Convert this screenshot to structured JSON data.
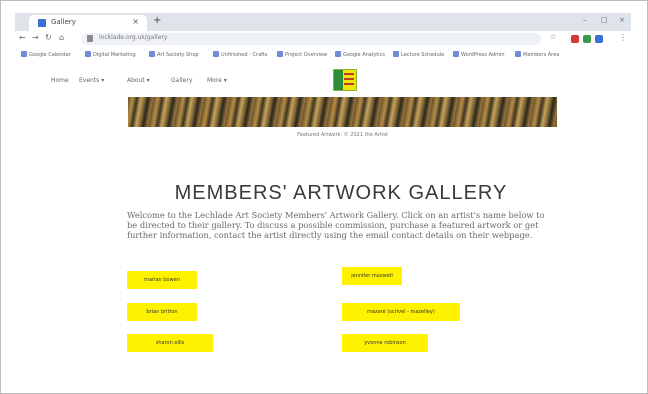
{
  "browser": {
    "tab_title": "Gallery",
    "new_tab_symbol": "+",
    "url": "locklade.org.uk/gallery",
    "window_controls": [
      "–",
      "□",
      "×"
    ],
    "bookmarks": [
      "Google Calendar",
      "Digital Marketing",
      "Art Society Shop",
      "Unfinished - Crafts",
      "Project Overview",
      "Google Analytics",
      "Lecture Schedule",
      "WordPress Admin",
      "Members Area"
    ]
  },
  "site_nav": {
    "items": [
      "Home",
      "Events ▾",
      "About ▾",
      "Gallery",
      "More ▾"
    ],
    "logo_alt": "Lechlade Art Society"
  },
  "banner": {
    "caption": "Featured Artwork: © 2021 the Artist"
  },
  "main": {
    "heading": "MEMBERS' ARTWORK GALLERY",
    "intro": "Welcome to the Lechlade Art Society Members' Artwork Gallery. Click on an artist's name below to be directed to their gallery. To discuss a possible commission, purchase a featured artwork or get further information, contact the artist directly using the email contact details on their webpage."
  },
  "artists": [
    "marian bowen",
    "jennifer maxwell",
    "brian britton",
    "mazaré (scrivel - mazelley)",
    "sharon ellis",
    "yvonne robinson"
  ],
  "colors": {
    "button_bg": "#fff200",
    "heading": "#3a3a3a"
  }
}
